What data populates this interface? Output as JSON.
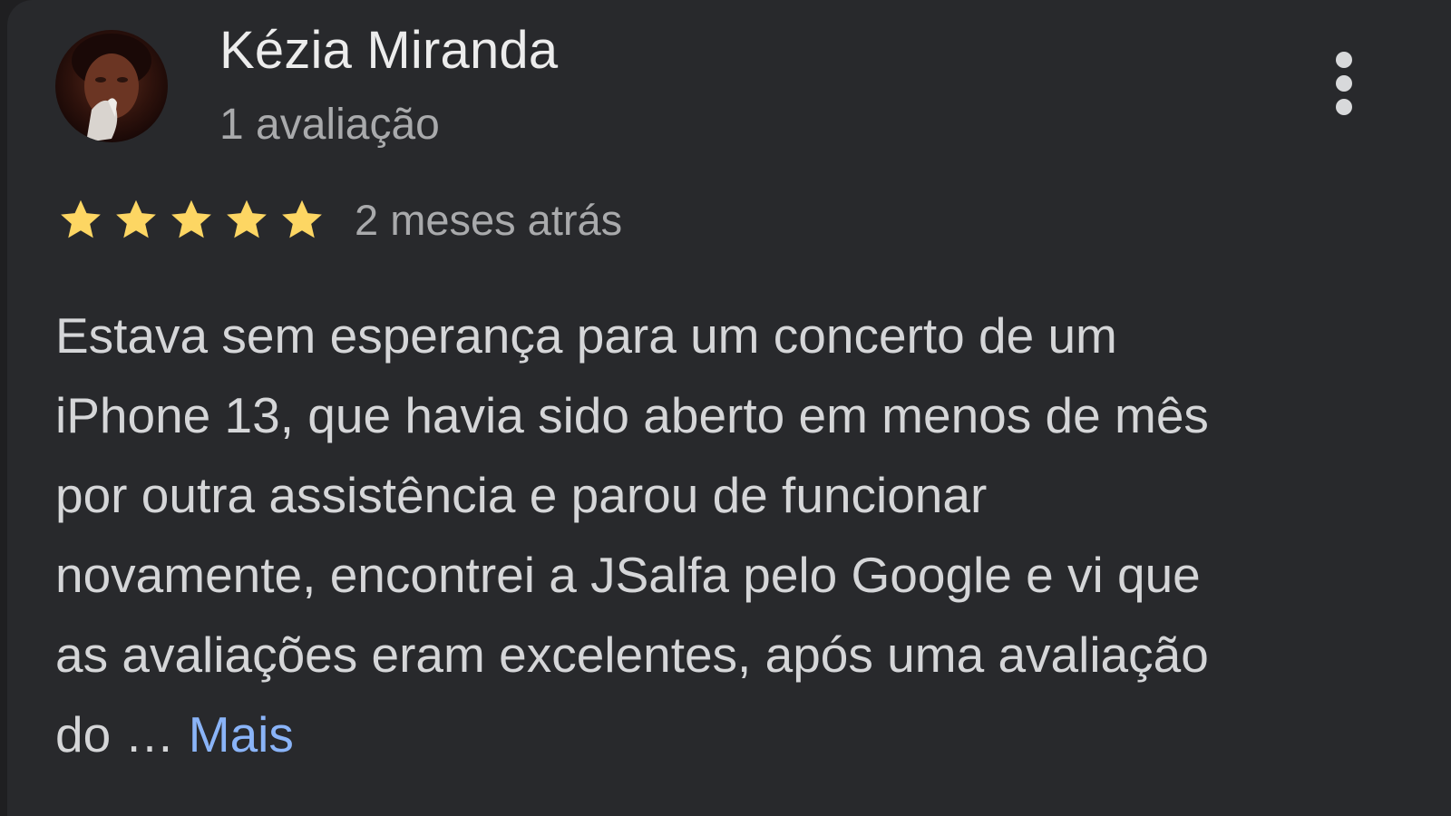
{
  "review": {
    "author_name": "Kézia Miranda",
    "author_reviews": "1 avaliação",
    "rating": 5,
    "rating_max": 5,
    "time_ago": "2 meses atrás",
    "text_lines": [
      "Estava sem esperança para um concerto de um",
      "iPhone 13, que havia sido aberto em menos de mês",
      "por outra assistência e parou de funcionar",
      "novamente, encontrei a JSalfa pelo Google e vi que",
      "as avaliações eram excelentes, após uma avaliação",
      "do …"
    ],
    "more_label": "Mais",
    "star_icon": "star-icon",
    "menu_icon": "more-vert-icon"
  },
  "colors": {
    "background": "#28292c",
    "star": "#fdd663",
    "link": "#8ab4f8",
    "name_text": "#ececec",
    "secondary_text": "#a9aaac",
    "body_text": "#d5d6d8"
  }
}
